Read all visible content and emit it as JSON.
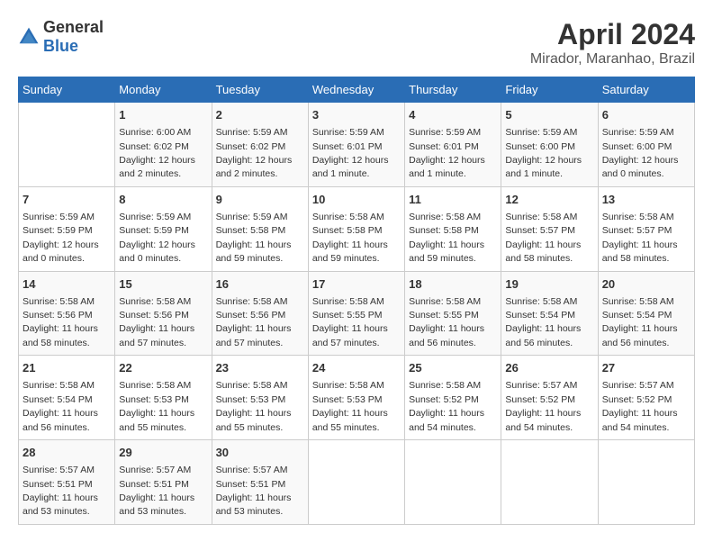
{
  "logo": {
    "general": "General",
    "blue": "Blue"
  },
  "title": "April 2024",
  "location": "Mirador, Maranhao, Brazil",
  "headers": [
    "Sunday",
    "Monday",
    "Tuesday",
    "Wednesday",
    "Thursday",
    "Friday",
    "Saturday"
  ],
  "weeks": [
    [
      {
        "day": "",
        "sunrise": "",
        "sunset": "",
        "daylight": ""
      },
      {
        "day": "1",
        "sunrise": "Sunrise: 6:00 AM",
        "sunset": "Sunset: 6:02 PM",
        "daylight": "Daylight: 12 hours and 2 minutes."
      },
      {
        "day": "2",
        "sunrise": "Sunrise: 5:59 AM",
        "sunset": "Sunset: 6:02 PM",
        "daylight": "Daylight: 12 hours and 2 minutes."
      },
      {
        "day": "3",
        "sunrise": "Sunrise: 5:59 AM",
        "sunset": "Sunset: 6:01 PM",
        "daylight": "Daylight: 12 hours and 1 minute."
      },
      {
        "day": "4",
        "sunrise": "Sunrise: 5:59 AM",
        "sunset": "Sunset: 6:01 PM",
        "daylight": "Daylight: 12 hours and 1 minute."
      },
      {
        "day": "5",
        "sunrise": "Sunrise: 5:59 AM",
        "sunset": "Sunset: 6:00 PM",
        "daylight": "Daylight: 12 hours and 1 minute."
      },
      {
        "day": "6",
        "sunrise": "Sunrise: 5:59 AM",
        "sunset": "Sunset: 6:00 PM",
        "daylight": "Daylight: 12 hours and 0 minutes."
      }
    ],
    [
      {
        "day": "7",
        "sunrise": "Sunrise: 5:59 AM",
        "sunset": "Sunset: 5:59 PM",
        "daylight": "Daylight: 12 hours and 0 minutes."
      },
      {
        "day": "8",
        "sunrise": "Sunrise: 5:59 AM",
        "sunset": "Sunset: 5:59 PM",
        "daylight": "Daylight: 12 hours and 0 minutes."
      },
      {
        "day": "9",
        "sunrise": "Sunrise: 5:59 AM",
        "sunset": "Sunset: 5:58 PM",
        "daylight": "Daylight: 11 hours and 59 minutes."
      },
      {
        "day": "10",
        "sunrise": "Sunrise: 5:58 AM",
        "sunset": "Sunset: 5:58 PM",
        "daylight": "Daylight: 11 hours and 59 minutes."
      },
      {
        "day": "11",
        "sunrise": "Sunrise: 5:58 AM",
        "sunset": "Sunset: 5:58 PM",
        "daylight": "Daylight: 11 hours and 59 minutes."
      },
      {
        "day": "12",
        "sunrise": "Sunrise: 5:58 AM",
        "sunset": "Sunset: 5:57 PM",
        "daylight": "Daylight: 11 hours and 58 minutes."
      },
      {
        "day": "13",
        "sunrise": "Sunrise: 5:58 AM",
        "sunset": "Sunset: 5:57 PM",
        "daylight": "Daylight: 11 hours and 58 minutes."
      }
    ],
    [
      {
        "day": "14",
        "sunrise": "Sunrise: 5:58 AM",
        "sunset": "Sunset: 5:56 PM",
        "daylight": "Daylight: 11 hours and 58 minutes."
      },
      {
        "day": "15",
        "sunrise": "Sunrise: 5:58 AM",
        "sunset": "Sunset: 5:56 PM",
        "daylight": "Daylight: 11 hours and 57 minutes."
      },
      {
        "day": "16",
        "sunrise": "Sunrise: 5:58 AM",
        "sunset": "Sunset: 5:56 PM",
        "daylight": "Daylight: 11 hours and 57 minutes."
      },
      {
        "day": "17",
        "sunrise": "Sunrise: 5:58 AM",
        "sunset": "Sunset: 5:55 PM",
        "daylight": "Daylight: 11 hours and 57 minutes."
      },
      {
        "day": "18",
        "sunrise": "Sunrise: 5:58 AM",
        "sunset": "Sunset: 5:55 PM",
        "daylight": "Daylight: 11 hours and 56 minutes."
      },
      {
        "day": "19",
        "sunrise": "Sunrise: 5:58 AM",
        "sunset": "Sunset: 5:54 PM",
        "daylight": "Daylight: 11 hours and 56 minutes."
      },
      {
        "day": "20",
        "sunrise": "Sunrise: 5:58 AM",
        "sunset": "Sunset: 5:54 PM",
        "daylight": "Daylight: 11 hours and 56 minutes."
      }
    ],
    [
      {
        "day": "21",
        "sunrise": "Sunrise: 5:58 AM",
        "sunset": "Sunset: 5:54 PM",
        "daylight": "Daylight: 11 hours and 56 minutes."
      },
      {
        "day": "22",
        "sunrise": "Sunrise: 5:58 AM",
        "sunset": "Sunset: 5:53 PM",
        "daylight": "Daylight: 11 hours and 55 minutes."
      },
      {
        "day": "23",
        "sunrise": "Sunrise: 5:58 AM",
        "sunset": "Sunset: 5:53 PM",
        "daylight": "Daylight: 11 hours and 55 minutes."
      },
      {
        "day": "24",
        "sunrise": "Sunrise: 5:58 AM",
        "sunset": "Sunset: 5:53 PM",
        "daylight": "Daylight: 11 hours and 55 minutes."
      },
      {
        "day": "25",
        "sunrise": "Sunrise: 5:58 AM",
        "sunset": "Sunset: 5:52 PM",
        "daylight": "Daylight: 11 hours and 54 minutes."
      },
      {
        "day": "26",
        "sunrise": "Sunrise: 5:57 AM",
        "sunset": "Sunset: 5:52 PM",
        "daylight": "Daylight: 11 hours and 54 minutes."
      },
      {
        "day": "27",
        "sunrise": "Sunrise: 5:57 AM",
        "sunset": "Sunset: 5:52 PM",
        "daylight": "Daylight: 11 hours and 54 minutes."
      }
    ],
    [
      {
        "day": "28",
        "sunrise": "Sunrise: 5:57 AM",
        "sunset": "Sunset: 5:51 PM",
        "daylight": "Daylight: 11 hours and 53 minutes."
      },
      {
        "day": "29",
        "sunrise": "Sunrise: 5:57 AM",
        "sunset": "Sunset: 5:51 PM",
        "daylight": "Daylight: 11 hours and 53 minutes."
      },
      {
        "day": "30",
        "sunrise": "Sunrise: 5:57 AM",
        "sunset": "Sunset: 5:51 PM",
        "daylight": "Daylight: 11 hours and 53 minutes."
      },
      {
        "day": "",
        "sunrise": "",
        "sunset": "",
        "daylight": ""
      },
      {
        "day": "",
        "sunrise": "",
        "sunset": "",
        "daylight": ""
      },
      {
        "day": "",
        "sunrise": "",
        "sunset": "",
        "daylight": ""
      },
      {
        "day": "",
        "sunrise": "",
        "sunset": "",
        "daylight": ""
      }
    ]
  ]
}
